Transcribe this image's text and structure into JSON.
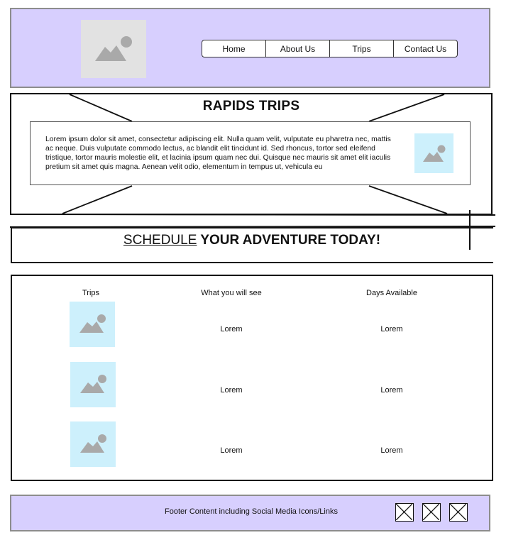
{
  "nav": {
    "items": [
      {
        "label": "Home"
      },
      {
        "label": "About Us"
      },
      {
        "label": "Trips"
      },
      {
        "label": "Contact Us"
      }
    ]
  },
  "hero": {
    "title": "RAPIDS TRIPS",
    "text": "Lorem ipsum dolor sit amet, consectetur adipiscing elit. Nulla quam velit, vulputate eu pharetra nec, mattis ac neque. Duis vulputate commodo lectus, ac blandit elit tincidunt id. Sed rhoncus, tortor sed eleifend tristique, tortor mauris molestie elit, et lacinia ipsum quam nec dui. Quisque nec mauris sit amet elit iaculis pretium sit amet quis magna. Aenean velit odio, elementum in tempus ut, vehicula eu"
  },
  "schedule": {
    "title_underlined": "SCHEDULE",
    "title_rest": " YOUR ADVENTURE TODAY!"
  },
  "trips_table": {
    "headers": [
      "Trips",
      "What you will see",
      "Days Available"
    ],
    "rows": [
      {
        "see": "Lorem",
        "days": "Lorem"
      },
      {
        "see": "Lorem",
        "days": "Lorem"
      },
      {
        "see": "Lorem",
        "days": "Lorem"
      }
    ]
  },
  "footer": {
    "text": "Footer Content including Social Media Icons/Links",
    "social_icons": [
      "social-link-1-icon",
      "social-link-2-icon",
      "social-link-3-icon"
    ]
  },
  "colors": {
    "header_bg": "#d7cffe",
    "image_placeholder": "#cdf0fc",
    "logo_placeholder": "#e2e2e2",
    "placeholder_glyph": "#a9a9a9"
  }
}
